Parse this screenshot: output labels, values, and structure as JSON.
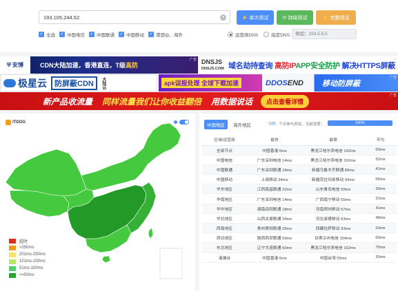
{
  "search": {
    "value": "193.105.244.52",
    "clear_icon": "×"
  },
  "buttons": {
    "single": {
      "icon": "⚡",
      "label": "单次测试"
    },
    "continuous": {
      "icon": "⟳",
      "label": "持续测试"
    },
    "complete": {
      "icon": "⚡",
      "label": "完整测试"
    }
  },
  "filters": [
    {
      "label": "全选",
      "checked": true
    },
    {
      "label": "中国电信",
      "checked": true
    },
    {
      "label": "中国联通",
      "checked": true
    },
    {
      "label": "中国移动",
      "checked": true
    },
    {
      "label": "港澳台、海外",
      "checked": true
    }
  ],
  "dns": {
    "option_isp": "运营商DNS",
    "option_custom": "指定DNS:",
    "placeholder": "例如：223.5.5.5",
    "selected": "isp"
  },
  "ads": {
    "ad_tag": "广告",
    "anquan": {
      "logo_icon": "shield-icon",
      "logo": "安博",
      "text_a": "CDN大陆加速，香港直连，T级",
      "text_b": "高防"
    },
    "dnsjs": {
      "logo": "DNSJS",
      "logo_sub": "DNSJS.COM",
      "t1": "域名劫持查询",
      "t2": "高防IP",
      "t3": "APP安全防护",
      "t4": "解决HTTPS屏蔽"
    },
    "jixing": {
      "brand": "极星云",
      "box": "防屏蔽CDN",
      "side": "大陆云"
    },
    "apk": {
      "text": "apk误报处理 全球下载加速"
    },
    "ddos": {
      "logo_a": "DDOS",
      "logo_b": "END",
      "text": "移动防屏蔽"
    },
    "wide": {
      "t1": "新产品收流量",
      "t2": "同样流量我们让你收益翻倍",
      "t3": "用数据说话",
      "cta": "点击查看详情"
    }
  },
  "map": {
    "brand": "ITDOG",
    "legend": [
      {
        "label": "超时",
        "color": "#d9321c"
      },
      {
        "label": ">250ms",
        "color": "#f29d1a"
      },
      {
        "label": "201ms-250ms",
        "color": "#f5e46b"
      },
      {
        "label": "101ms-200ms",
        "color": "#b8e86a"
      },
      {
        "label": "51ms-100ms",
        "color": "#4fd16a"
      },
      {
        "label": "<=50ms",
        "color": "#2aa62f"
      }
    ],
    "colors": {
      "light": "#44c93f",
      "mid": "#35b136",
      "dark": "#239a28"
    }
  },
  "results": {
    "tabs": [
      "中国地区",
      "海外地区"
    ],
    "active_tab": 0,
    "progress_count": "120",
    "progress_label": "个点参与测试，当前进度：",
    "progress_value": "100%",
    "progress_fraction": 1.0,
    "headers": [
      "区域/运营商",
      "最快",
      "最慢",
      "平均"
    ],
    "rows": [
      [
        "全部节点",
        "中国香港 6ms",
        "黑龙江哈尔滨电信 162ms",
        "50ms"
      ],
      [
        "中国电信",
        "广东深圳电信 14ms",
        "黑龙江哈尔滨电信 162ms",
        "52ms"
      ],
      [
        "中国联通",
        "广东深圳联通 18ms",
        "新疆乌鲁木齐联通 89ms",
        "41ms"
      ],
      [
        "中国移动",
        "上海移动 34ms",
        "新疆克拉玛依移动 93ms",
        "56ms"
      ],
      [
        "华东地区",
        "江西南昌联通 22ms",
        "山东青岛电信 59ms",
        "39ms"
      ],
      [
        "华南地区",
        "广东深圳电信 14ms",
        "广西南宁移动 55ms",
        "31ms"
      ],
      [
        "华中地区",
        "湖南岳阳联通 18ms",
        "河南郑州移动 57ms",
        "41ms"
      ],
      [
        "华北地区",
        "山西太原联通 24ms",
        "河北承德移动 63ms",
        "48ms"
      ],
      [
        "西南地区",
        "贵州贵阳联通 26ms",
        "西藏拉萨移动 93ms",
        "53ms"
      ],
      [
        "西北地区",
        "陕西西安联通 59ms",
        "甘肃兰州电信 154ms",
        "69ms"
      ],
      [
        "东北地区",
        "辽宁大连联通 60ms",
        "黑龙江哈尔滨电信 162ms",
        "75ms"
      ],
      [
        "港澳台",
        "中国香港 6ms",
        "中国台湾 55ms",
        "30ms"
      ]
    ]
  }
}
